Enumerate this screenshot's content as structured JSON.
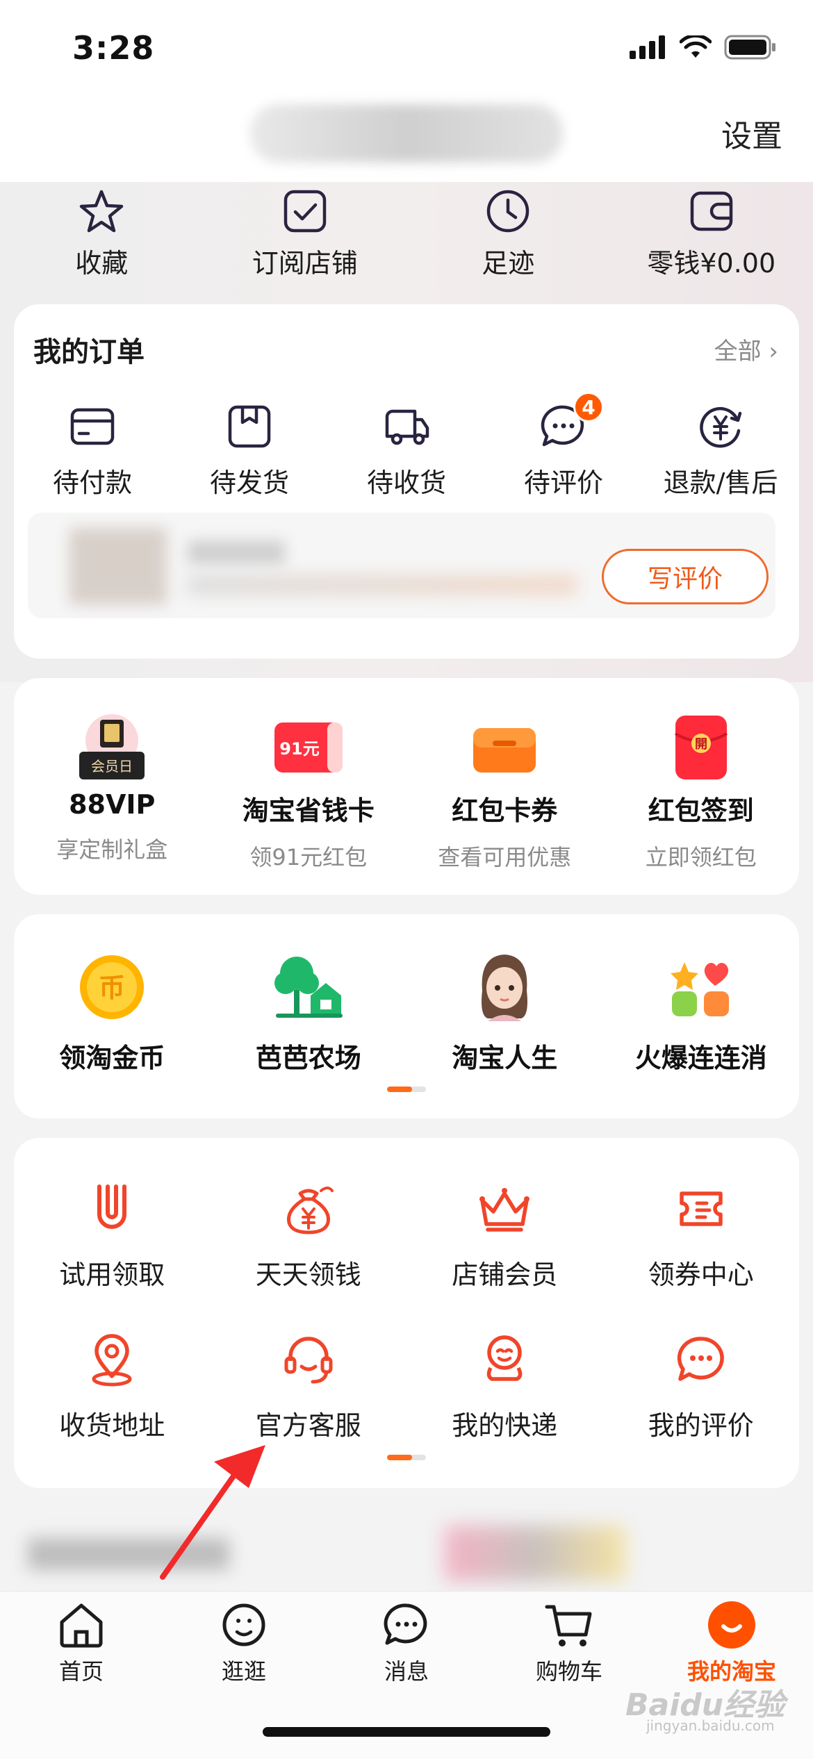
{
  "status_bar": {
    "time": "3:28"
  },
  "header": {
    "settings_label": "设置"
  },
  "quick_links": [
    {
      "label": "收藏",
      "icon": "star-icon"
    },
    {
      "label": "订阅店铺",
      "icon": "checkbox-icon"
    },
    {
      "label": "足迹",
      "icon": "clock-icon"
    },
    {
      "label": "零钱¥0.00",
      "icon": "wallet-icon"
    }
  ],
  "orders": {
    "title": "我的订单",
    "all_label": "全部 ›",
    "items": [
      {
        "label": "待付款",
        "icon": "card-icon"
      },
      {
        "label": "待发货",
        "icon": "box-icon"
      },
      {
        "label": "待收货",
        "icon": "truck-icon"
      },
      {
        "label": "待评价",
        "icon": "chat-bubble-icon",
        "badge": "4"
      },
      {
        "label": "退款/售后",
        "icon": "refund-icon"
      }
    ],
    "review_button": "写评价"
  },
  "benefits": [
    {
      "title": "88VIP",
      "sub": "享定制礼盒",
      "icon": "vip-gift-icon",
      "tag": "会员日"
    },
    {
      "title": "淘宝省钱卡",
      "sub": "领91元红包",
      "icon": "saving-card-icon",
      "tag": "91元"
    },
    {
      "title": "红包卡券",
      "sub": "查看可用优惠",
      "icon": "coupon-wallet-icon"
    },
    {
      "title": "红包签到",
      "sub": "立即领红包",
      "icon": "red-envelope-icon",
      "tag": "開"
    }
  ],
  "games": [
    {
      "label": "领淘金币",
      "icon": "gold-coin-icon",
      "coin_char": "币"
    },
    {
      "label": "芭芭农场",
      "icon": "farm-icon"
    },
    {
      "label": "淘宝人生",
      "icon": "avatar-icon"
    },
    {
      "label": "火爆连连消",
      "icon": "match-game-icon"
    }
  ],
  "tools": [
    {
      "label": "试用领取",
      "icon": "trial-icon"
    },
    {
      "label": "天天领钱",
      "icon": "money-bag-icon"
    },
    {
      "label": "店铺会员",
      "icon": "crown-icon"
    },
    {
      "label": "领券中心",
      "icon": "ticket-icon"
    },
    {
      "label": "收货地址",
      "icon": "location-icon"
    },
    {
      "label": "官方客服",
      "icon": "headset-icon"
    },
    {
      "label": "我的快递",
      "icon": "courier-icon"
    },
    {
      "label": "我的评价",
      "icon": "comment-icon"
    }
  ],
  "tabbar": [
    {
      "label": "首页",
      "icon": "home-icon"
    },
    {
      "label": "逛逛",
      "icon": "explore-icon"
    },
    {
      "label": "消息",
      "icon": "message-icon"
    },
    {
      "label": "购物车",
      "icon": "cart-icon"
    },
    {
      "label": "我的淘宝",
      "icon": "taobao-face-icon",
      "active": true
    }
  ],
  "watermark": {
    "brand": "Baidu经验",
    "url": "jingyan.baidu.com"
  },
  "colors": {
    "accent": "#ff5000",
    "icon_red": "#f0452a",
    "badge": "#ff5a00"
  }
}
